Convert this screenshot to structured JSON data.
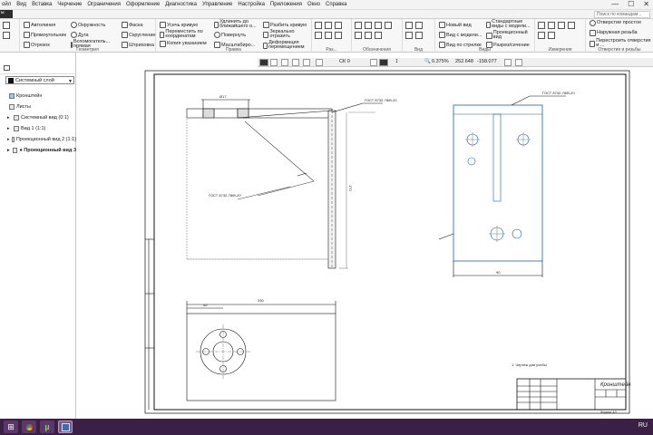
{
  "menubar": {
    "items": [
      "ойл",
      "Вид",
      "Вставка",
      "Черчение",
      "Ограничения",
      "Оформление",
      "Диагностика",
      "Управление",
      "Настройка",
      "Приложения",
      "Окно",
      "Справка"
    ]
  },
  "search": {
    "placeholder": "Поиск по командам..."
  },
  "ribbon": {
    "groups": [
      {
        "label": "",
        "items": []
      },
      {
        "label": "Геометрия",
        "items": [
          "Автолиния",
          "Прямоугольник",
          "Отрезок",
          "Окружность",
          "Дуга",
          "Вспомогатель... прямая",
          "Фаска",
          "Скругление",
          "Штриховка"
        ]
      },
      {
        "label": "Правка",
        "items": [
          "Усечь кривую",
          "Переместить по координатам",
          "Копия указанием",
          "Удлинить до ближайшего о...",
          "Повернуть",
          "Масштабиро...",
          "Разбить кривую",
          "Зеркально отразить",
          "Деформация перемещением"
        ]
      },
      {
        "label": "Раз...",
        "items": []
      },
      {
        "label": "Обозначения",
        "items": []
      },
      {
        "label": "Вид",
        "items": []
      },
      {
        "label": "Виды",
        "items": [
          "Новый вид",
          "Вид с модели...",
          "Вид по стрелке",
          "Стандартные виды с модели...",
          "Проекционный вид",
          "Разрез/сечение"
        ]
      },
      {
        "label": "Измерения",
        "items": []
      },
      {
        "label": "Отверстия и резьбы",
        "items": [
          "Отверстие простое",
          "Наружная резьба",
          "Перестроить отверстия и ..."
        ]
      }
    ]
  },
  "toolbar2": {
    "cs": "СК 0",
    "step": "1",
    "zoom": "0.375",
    "x": "252.648",
    "y": "-158.077"
  },
  "panel": {
    "layer": "Системный слой",
    "tree": [
      {
        "label": "Кронштейн",
        "bold": false,
        "indent": 0
      },
      {
        "label": "Листы",
        "bold": false,
        "indent": 0
      },
      {
        "label": "Системный вид (0:1)",
        "bold": false,
        "indent": 1
      },
      {
        "label": "Вид 1 (1:1)",
        "bold": false,
        "indent": 1
      },
      {
        "label": "Проекционный вид 2 (1:1)",
        "bold": false,
        "indent": 1
      },
      {
        "label": "● Проекционный вид 3",
        "bold": true,
        "indent": 1
      }
    ]
  },
  "drawing": {
    "dim_top_left": "Ø17",
    "dim_top_width": "250",
    "dim_top_small": "40",
    "dim_right_width": "90",
    "dim_height": "170",
    "note_left": "ГОСТ 8732-78/В-20",
    "note_left2": "ГОСТ 8732-78/В-20",
    "note_right": "ГОСТ 8732-78/В-20",
    "tech_req": "1. Чертеж для учебы",
    "title_block_name": "Кронштейн",
    "sheet_label": "Формат А3"
  },
  "taskbar": {
    "lang": "RU"
  }
}
